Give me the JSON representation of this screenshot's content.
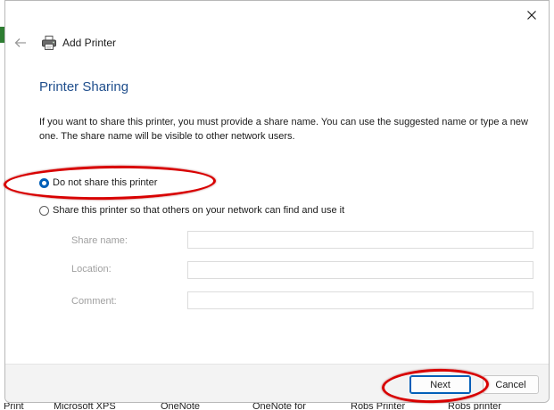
{
  "window": {
    "title": "Add Printer",
    "close_icon": "close-icon"
  },
  "page": {
    "heading": "Printer Sharing",
    "description": "If you want to share this printer, you must provide a share name. You can use the suggested name or type a new one. The share name will be visible to other network users."
  },
  "sharing_options": [
    {
      "label": "Do not share this printer",
      "checked": true
    },
    {
      "label": "Share this printer so that others on your network can find and use it",
      "checked": false
    }
  ],
  "fields": {
    "share_name": {
      "label": "Share name:",
      "value": ""
    },
    "location": {
      "label": "Location:",
      "value": ""
    },
    "comment": {
      "label": "Comment:",
      "value": ""
    }
  },
  "buttons": {
    "next": "Next",
    "cancel": "Cancel"
  },
  "background": {
    "taskbar_labels": [
      "Print",
      "Microsoft XPS",
      "OneNote",
      "OneNote for",
      "Robs Printer",
      "Robs printer"
    ]
  },
  "colors": {
    "accent": "#005fb8",
    "heading": "#1f4e8c",
    "annotation": "#d80000"
  }
}
